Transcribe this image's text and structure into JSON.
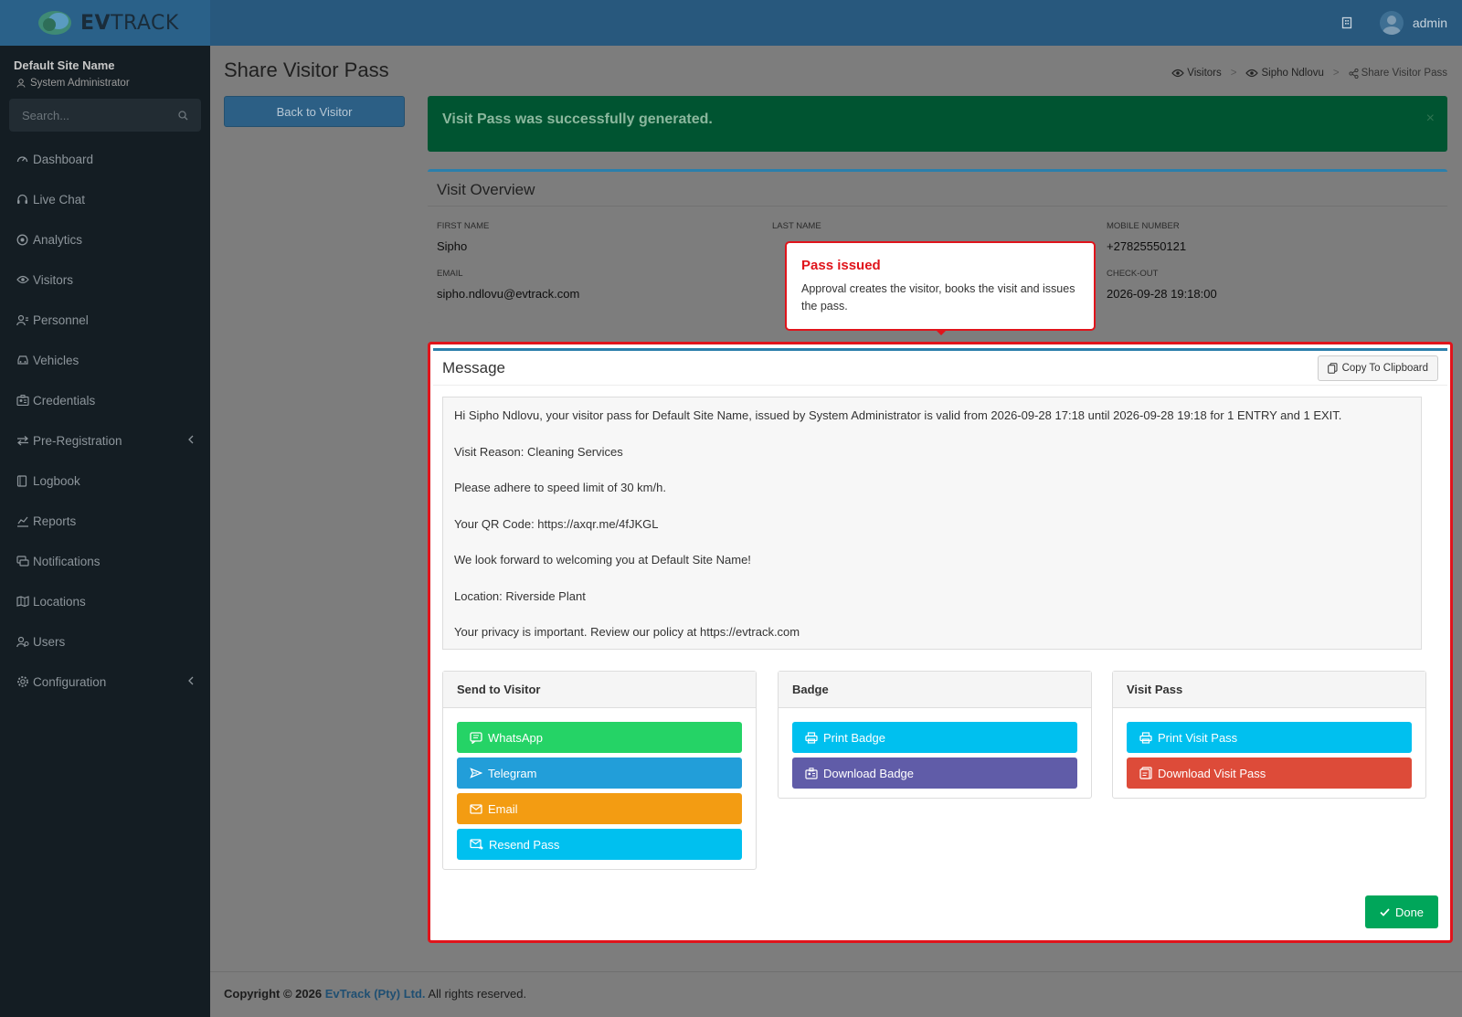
{
  "app": {
    "logo_text_bold": "EV",
    "logo_text_light": "TRACK",
    "user_name": "admin",
    "icons": {
      "grid": "building-icon",
      "avatar": "user-avatar"
    }
  },
  "sidebar": {
    "site_name": "Default Site Name",
    "role": "System Administrator",
    "search_placeholder": "Search...",
    "items": [
      {
        "label": "Dashboard",
        "icon": "dashboard-icon"
      },
      {
        "label": "Live Chat",
        "icon": "headset-icon"
      },
      {
        "label": "Analytics",
        "icon": "analytics-icon"
      },
      {
        "label": "Visitors",
        "icon": "eye-icon"
      },
      {
        "label": "Personnel",
        "icon": "personnel-icon"
      },
      {
        "label": "Vehicles",
        "icon": "car-icon"
      },
      {
        "label": "Credentials",
        "icon": "id-card-icon"
      },
      {
        "label": "Pre-Registration",
        "icon": "arrows-icon",
        "expandable": true
      },
      {
        "label": "Logbook",
        "icon": "book-icon"
      },
      {
        "label": "Reports",
        "icon": "chart-icon"
      },
      {
        "label": "Notifications",
        "icon": "chat-icon"
      },
      {
        "label": "Locations",
        "icon": "map-icon"
      },
      {
        "label": "Users",
        "icon": "users-icon"
      },
      {
        "label": "Configuration",
        "icon": "gear-icon",
        "expandable": true
      }
    ]
  },
  "page": {
    "title": "Share Visitor Pass",
    "back_button": "Back to Visitor",
    "breadcrumb": [
      "Visitors",
      "Sipho Ndlovu",
      "Share Visitor Pass"
    ]
  },
  "alert": {
    "message": "Visit Pass was successfully generated.",
    "close": "×"
  },
  "overview": {
    "title": "Visit Overview",
    "first_name_label": "FIRST NAME",
    "first_name": "Sipho",
    "last_name_label": "LAST NAME",
    "mobile_label": "MOBILE NUMBER",
    "mobile": "+27825550121",
    "email_label": "EMAIL",
    "email": "sipho.ndlovu@evtrack.com",
    "checkout_label": "CHECK-OUT",
    "checkout": "2026-09-28 19:18:00"
  },
  "tooltip": {
    "title": "Pass issued",
    "body": "Approval creates the visitor, books the visit and issues the pass."
  },
  "message": {
    "title": "Message",
    "copy_button": "Copy To Clipboard",
    "lines": [
      "Hi Sipho Ndlovu, your visitor pass for Default Site Name, issued by System Administrator is valid from 2026-09-28 17:18 until 2026-09-28 19:18 for 1 ENTRY and 1 EXIT.",
      "Visit Reason: Cleaning Services",
      "Please adhere to speed limit of 30 km/h.",
      "Your QR Code: https://axqr.me/4fJKGL",
      "We look forward to welcoming you at Default Site Name!",
      "Location:  Riverside Plant",
      "Your privacy is important. Review our policy at https://evtrack.com"
    ]
  },
  "cards": {
    "send": {
      "title": "Send to Visitor",
      "buttons": [
        {
          "label": "WhatsApp",
          "color": "#25d366",
          "icon": "chat-icon"
        },
        {
          "label": "Telegram",
          "color": "#229ed9",
          "icon": "send-icon"
        },
        {
          "label": "Email",
          "color": "#f39c12",
          "icon": "mail-icon"
        },
        {
          "label": "Resend Pass",
          "color": "#00c0ef",
          "icon": "mail-forward-icon"
        }
      ]
    },
    "badge": {
      "title": "Badge",
      "buttons": [
        {
          "label": "Print Badge",
          "color": "#00c0ef",
          "icon": "printer-icon"
        },
        {
          "label": "Download Badge",
          "color": "#605ca8",
          "icon": "id-badge-icon"
        }
      ]
    },
    "pass": {
      "title": "Visit Pass",
      "buttons": [
        {
          "label": "Print Visit Pass",
          "color": "#00c0ef",
          "icon": "printer-icon"
        },
        {
          "label": "Download Visit Pass",
          "color": "#dd4b39",
          "icon": "pdf-icon"
        }
      ]
    }
  },
  "done_button": "Done",
  "footer": {
    "prefix": "Copyright © 2026",
    "brand": "EvTrack (Pty) Ltd.",
    "suffix": "All rights reserved."
  }
}
